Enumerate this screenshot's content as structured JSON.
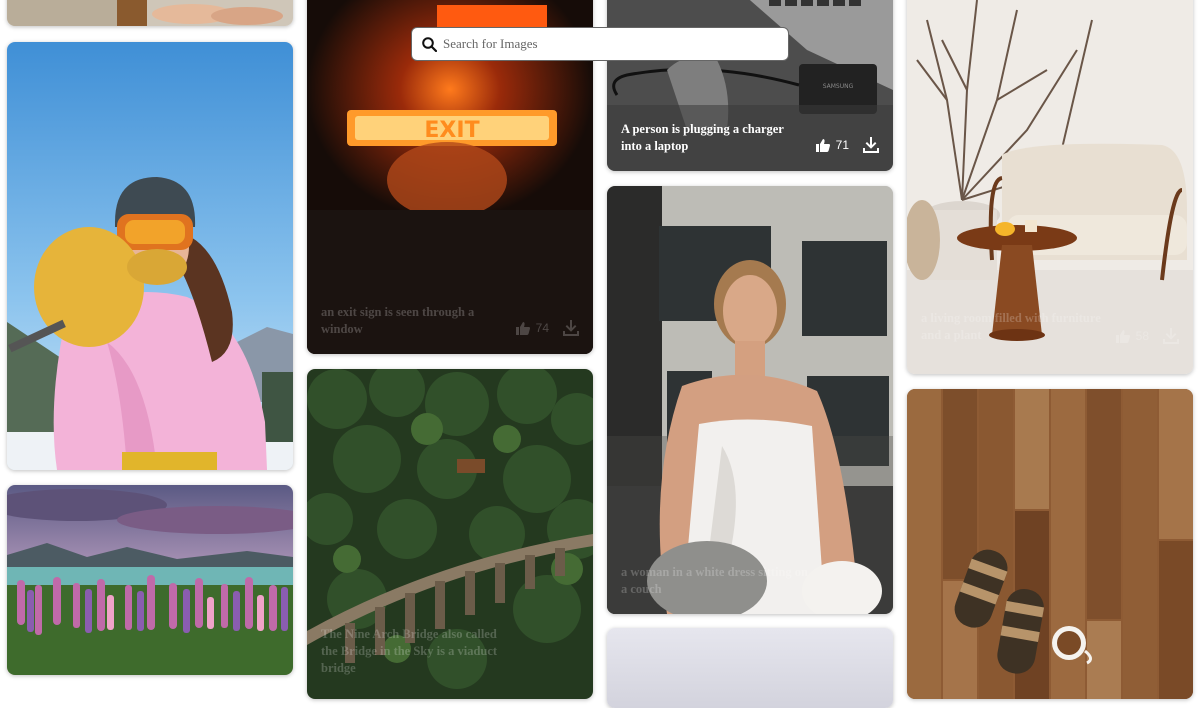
{
  "search": {
    "placeholder": "Search for Images",
    "value": ""
  },
  "cards": [
    {
      "id": "col1-top",
      "caption": ""
    },
    {
      "id": "skier",
      "caption": ""
    },
    {
      "id": "lupins",
      "caption": ""
    },
    {
      "id": "exit",
      "caption": "an exit sign is seen through a window",
      "likes": "74"
    },
    {
      "id": "bridge",
      "caption": "The Nine Arch Bridge also called the Bridge in the Sky is a viaduct bridge"
    },
    {
      "id": "laptop",
      "caption": "A person is plugging a charger into a laptop",
      "likes": "71"
    },
    {
      "id": "woman",
      "caption": "a woman in a white dress sitting on a couch"
    },
    {
      "id": "col3-bottom",
      "caption": ""
    },
    {
      "id": "living-room",
      "caption": "a living room filled with furniture and a plant",
      "likes": "58"
    },
    {
      "id": "floor",
      "caption": ""
    }
  ],
  "icons": {
    "like": "thumbs-up-icon",
    "download": "download-icon",
    "search": "search-icon"
  },
  "colors": {
    "caption_text": "#ffffff",
    "search_border": "#666666"
  }
}
